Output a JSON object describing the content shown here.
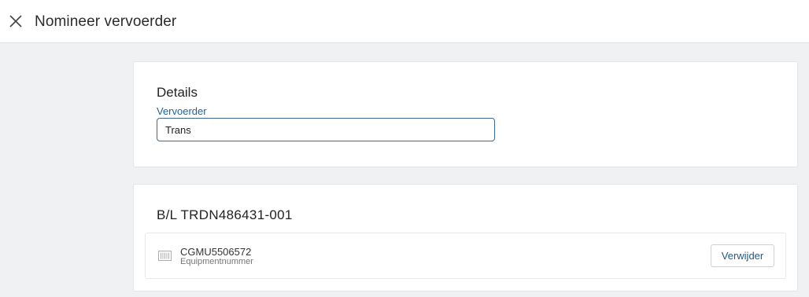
{
  "header": {
    "close_icon": "close-icon",
    "title": "Nomineer vervoerder"
  },
  "details": {
    "title": "Details",
    "carrier_label": "Vervoerder",
    "carrier_value": "Trans"
  },
  "bill_of_lading": {
    "title": "B/L TRDN486431-001",
    "equipment": [
      {
        "icon": "container-icon",
        "number": "CGMU5506572",
        "sublabel": "Equipmentnummer",
        "remove_label": "Verwijder"
      }
    ]
  },
  "colors": {
    "accent": "#1f6496",
    "background": "#f0f1f3"
  }
}
